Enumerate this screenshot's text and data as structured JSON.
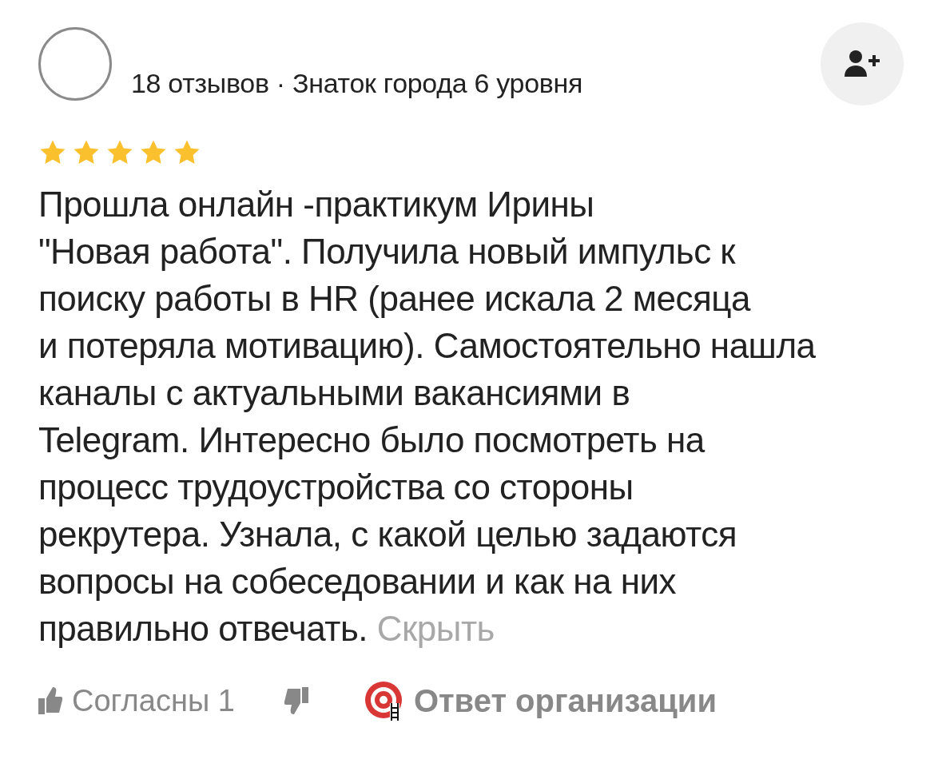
{
  "author": {
    "meta": "18 отзывов · Знаток города 6 уровня"
  },
  "rating": {
    "stars": 5
  },
  "review": {
    "lines": [
      "Прошла онлайн -практикум Ирины",
      "\"Новая работа\". Получила новый импульс к",
      "поиску работы в HR (ранее искала 2 месяца",
      "и потеряла мотивацию). Самостоятельно нашла",
      "каналы с актуальными вакансиями в",
      "Telegram. Интересно было посмотреть на",
      "процесс трудоустройства со стороны",
      "рекрутера. Узнала, с какой целью задаются",
      "вопросы на собеседовании и как на них",
      "правильно отвечать."
    ],
    "toggle": "Скрыть"
  },
  "actions": {
    "like": "Согласны 1",
    "reply": "Ответ организации"
  }
}
